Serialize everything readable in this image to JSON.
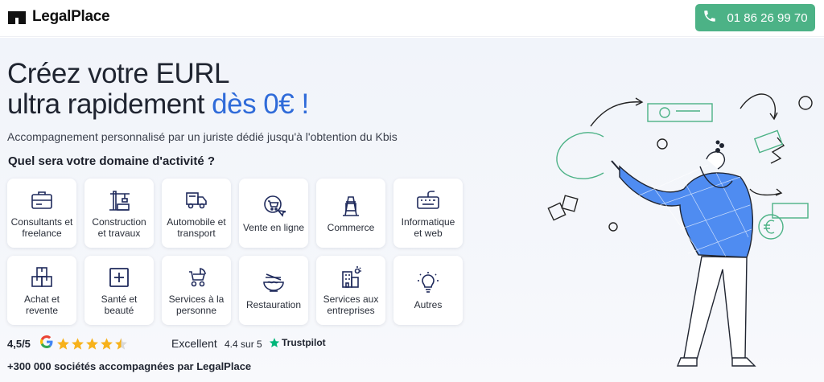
{
  "header": {
    "logo_text": "LegalPlace",
    "phone": "01 86 26 99 70"
  },
  "hero": {
    "title_line1": "Créez votre EURL",
    "title_line2_plain": "ultra rapidement ",
    "title_line2_accent": "dès 0€ !",
    "subtitle": "Accompagnement personnalisé par un juriste dédié jusqu'à l'obtention du Kbis",
    "question": "Quel sera votre domaine d'activité ?"
  },
  "categories": [
    {
      "label": "Consultants et freelance",
      "icon": "briefcase-icon"
    },
    {
      "label": "Construction et travaux",
      "icon": "crane-icon"
    },
    {
      "label": "Automobile et transport",
      "icon": "truck-icon"
    },
    {
      "label": "Vente en ligne",
      "icon": "online-cart-icon"
    },
    {
      "label": "Commerce",
      "icon": "sign-board-icon"
    },
    {
      "label": "Informatique et web",
      "icon": "keyboard-icon"
    },
    {
      "label": "Achat et revente",
      "icon": "boxes-icon"
    },
    {
      "label": "Santé et beauté",
      "icon": "medical-cross-icon"
    },
    {
      "label": "Services à la personne",
      "icon": "stroller-icon"
    },
    {
      "label": "Restauration",
      "icon": "noodle-bowl-icon"
    },
    {
      "label": "Services aux entreprises",
      "icon": "office-building-icon"
    },
    {
      "label": "Autres",
      "icon": "lightbulb-icon"
    }
  ],
  "ratings": {
    "google_score": "4,5/5",
    "google_stars": 4.5,
    "trustpilot_label": "Excellent",
    "trustpilot_score": "4.4 sur 5",
    "trustpilot_brand": "Trustpilot"
  },
  "footnote": "+300 000 sociétés accompagnées par LegalPlace",
  "colors": {
    "accent_blue": "#2f6bd9",
    "phone_green": "#4cb286",
    "star_yellow": "#f7b21b",
    "trustpilot_green": "#00b67a"
  }
}
